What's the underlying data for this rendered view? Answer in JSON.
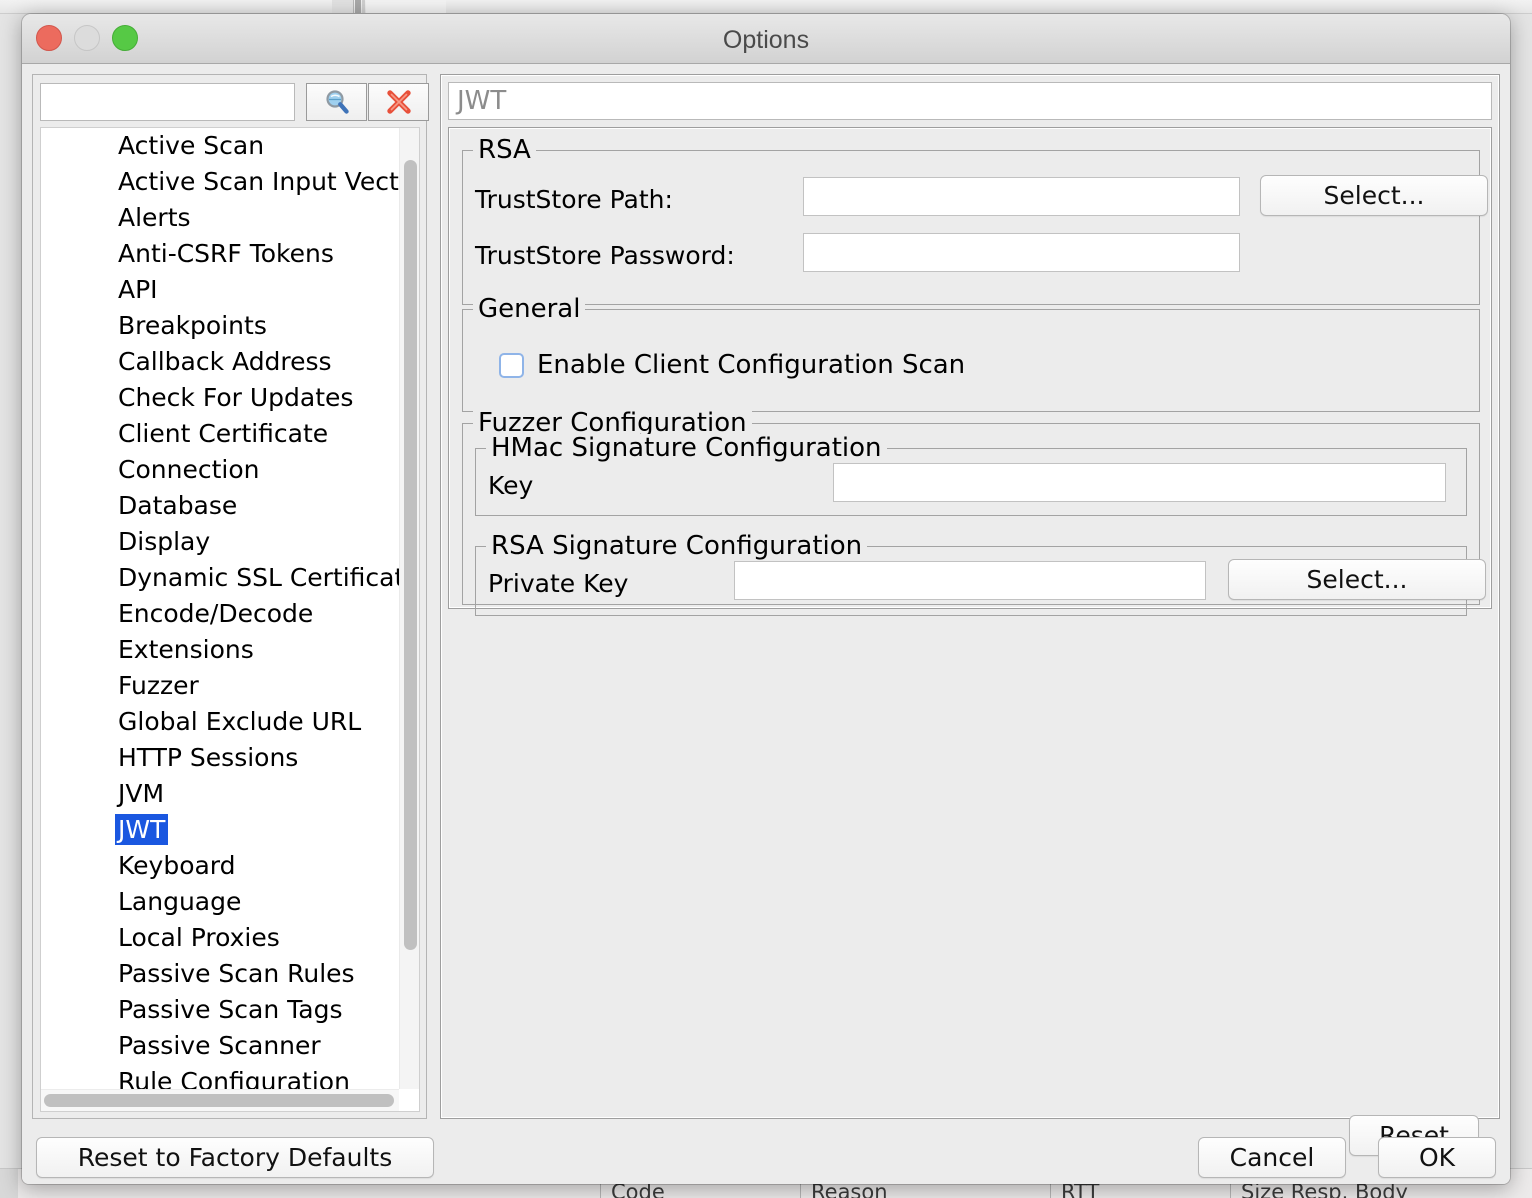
{
  "background": {
    "table_columns": [
      "Code",
      "Reason",
      "RTT",
      "Size Resp. Body"
    ]
  },
  "window": {
    "title": "Options",
    "traffic_lights": {
      "close": "close-window-button",
      "minimize": "minimize-window-button",
      "maximize": "maximize-window-button"
    }
  },
  "sidebar": {
    "search": {
      "value": "",
      "placeholder": ""
    },
    "buttons": {
      "search_label": "search-icon",
      "clear_label": "clear-icon"
    },
    "selected": "JWT",
    "items": [
      {
        "label": "Active Scan"
      },
      {
        "label": "Active Scan Input Vectors"
      },
      {
        "label": "Alerts"
      },
      {
        "label": "Anti-CSRF Tokens"
      },
      {
        "label": "API"
      },
      {
        "label": "Breakpoints"
      },
      {
        "label": "Callback Address"
      },
      {
        "label": "Check For Updates"
      },
      {
        "label": "Client Certificate"
      },
      {
        "label": "Connection"
      },
      {
        "label": "Database"
      },
      {
        "label": "Display"
      },
      {
        "label": "Dynamic SSL Certificates"
      },
      {
        "label": "Encode/Decode"
      },
      {
        "label": "Extensions"
      },
      {
        "label": "Fuzzer"
      },
      {
        "label": "Global Exclude URL"
      },
      {
        "label": "HTTP Sessions"
      },
      {
        "label": "JVM"
      },
      {
        "label": "JWT"
      },
      {
        "label": "Keyboard"
      },
      {
        "label": "Language"
      },
      {
        "label": "Local Proxies"
      },
      {
        "label": "Passive Scan Rules"
      },
      {
        "label": "Passive Scan Tags"
      },
      {
        "label": "Passive Scanner"
      },
      {
        "label": "Rule Configuration"
      }
    ]
  },
  "panel": {
    "header_title": "JWT",
    "rsa": {
      "group_title": "RSA",
      "truststore_path_label": "TrustStore Path:",
      "truststore_path_value": "",
      "truststore_path_select": "Select...",
      "truststore_password_label": "TrustStore Password:",
      "truststore_password_value": ""
    },
    "general": {
      "group_title": "General",
      "enable_client_configuration_scan_label": "Enable Client Configuration Scan",
      "enable_client_configuration_scan_checked": false
    },
    "fuzzer": {
      "group_title": "Fuzzer Configuration",
      "hmac": {
        "group_title": "HMac Signature Configuration",
        "key_label": "Key",
        "key_value": ""
      },
      "rsa_sig": {
        "group_title": "RSA Signature Configuration",
        "private_key_label": "Private Key",
        "private_key_value": "",
        "private_key_select": "Select..."
      }
    },
    "reset_label": "Reset"
  },
  "footer": {
    "reset_to_factory_defaults": "Reset to Factory Defaults",
    "cancel": "Cancel",
    "ok": "OK"
  },
  "colors": {
    "selection_blue": "#1a57e0",
    "checkbox_border": "#8fb4e8",
    "close_red": "#ec6b5e",
    "maximize_green": "#56c945",
    "minimize_gray": "#dcdcdc",
    "header_text_gray": "#8c8c8c"
  }
}
